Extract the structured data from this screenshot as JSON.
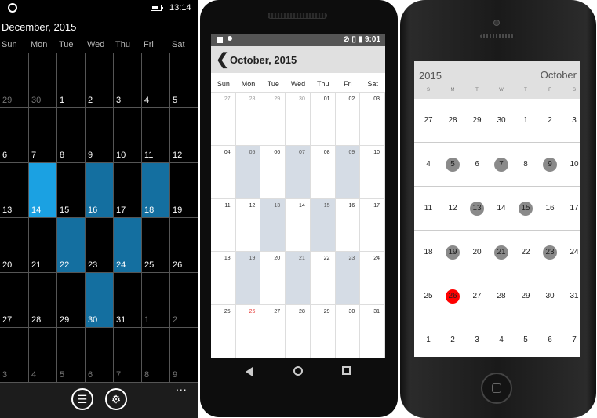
{
  "windows_phone": {
    "status": {
      "time": "13:14"
    },
    "month_title": "December, 2015",
    "weekdays": [
      "Sun",
      "Mon",
      "Tue",
      "Wed",
      "Thu",
      "Fri",
      "Sat"
    ],
    "weeks": [
      [
        {
          "d": "29",
          "o": true
        },
        {
          "d": "30",
          "o": true
        },
        {
          "d": "1"
        },
        {
          "d": "2"
        },
        {
          "d": "3"
        },
        {
          "d": "4"
        },
        {
          "d": "5"
        }
      ],
      [
        {
          "d": "6"
        },
        {
          "d": "7"
        },
        {
          "d": "8"
        },
        {
          "d": "9"
        },
        {
          "d": "10"
        },
        {
          "d": "11"
        },
        {
          "d": "12"
        }
      ],
      [
        {
          "d": "13"
        },
        {
          "d": "14",
          "s": "a"
        },
        {
          "d": "15"
        },
        {
          "d": "16",
          "s": "b"
        },
        {
          "d": "17"
        },
        {
          "d": "18",
          "s": "b"
        },
        {
          "d": "19"
        }
      ],
      [
        {
          "d": "20"
        },
        {
          "d": "21"
        },
        {
          "d": "22",
          "s": "b"
        },
        {
          "d": "23"
        },
        {
          "d": "24",
          "s": "b"
        },
        {
          "d": "25"
        },
        {
          "d": "26"
        }
      ],
      [
        {
          "d": "27"
        },
        {
          "d": "28"
        },
        {
          "d": "29"
        },
        {
          "d": "30",
          "s": "b"
        },
        {
          "d": "31"
        },
        {
          "d": "1",
          "o": true
        },
        {
          "d": "2",
          "o": true
        }
      ],
      [
        {
          "d": "3",
          "o": true
        },
        {
          "d": "4",
          "o": true
        },
        {
          "d": "5",
          "o": true
        },
        {
          "d": "6",
          "o": true
        },
        {
          "d": "7",
          "o": true
        },
        {
          "d": "8",
          "o": true
        },
        {
          "d": "9",
          "o": true
        }
      ]
    ],
    "appbar": {
      "list_icon": "list-icon",
      "settings_icon": "gear-icon",
      "more": "..."
    }
  },
  "android": {
    "status": {
      "time": "9:01"
    },
    "month_title": "October, 2015",
    "back_glyph": "❮",
    "weekdays": [
      "Sun",
      "Mon",
      "Tue",
      "Wed",
      "Thu",
      "Fri",
      "Sat"
    ],
    "weeks": [
      [
        {
          "d": "27",
          "o": true
        },
        {
          "d": "28",
          "o": true
        },
        {
          "d": "29",
          "o": true
        },
        {
          "d": "30",
          "o": true
        },
        {
          "d": "01"
        },
        {
          "d": "02"
        },
        {
          "d": "03"
        }
      ],
      [
        {
          "d": "04"
        },
        {
          "d": "05",
          "sh": true
        },
        {
          "d": "06"
        },
        {
          "d": "07",
          "sh": true
        },
        {
          "d": "08"
        },
        {
          "d": "09",
          "sh": true
        },
        {
          "d": "10"
        }
      ],
      [
        {
          "d": "11"
        },
        {
          "d": "12"
        },
        {
          "d": "13",
          "sh": true
        },
        {
          "d": "14"
        },
        {
          "d": "15",
          "sh": true
        },
        {
          "d": "16"
        },
        {
          "d": "17"
        }
      ],
      [
        {
          "d": "18"
        },
        {
          "d": "19",
          "sh": true
        },
        {
          "d": "20"
        },
        {
          "d": "21",
          "sh": true
        },
        {
          "d": "22"
        },
        {
          "d": "23",
          "sh": true
        },
        {
          "d": "24"
        }
      ],
      [
        {
          "d": "25"
        },
        {
          "d": "26",
          "red": true
        },
        {
          "d": "27"
        },
        {
          "d": "28"
        },
        {
          "d": "29"
        },
        {
          "d": "30"
        },
        {
          "d": "31"
        }
      ]
    ]
  },
  "iphone": {
    "year": "2015",
    "month": "October",
    "weekdays": [
      "S",
      "M",
      "T",
      "W",
      "T",
      "F",
      "S"
    ],
    "weeks": [
      [
        {
          "d": "27"
        },
        {
          "d": "28"
        },
        {
          "d": "29"
        },
        {
          "d": "30"
        },
        {
          "d": "1"
        },
        {
          "d": "2"
        },
        {
          "d": "3"
        }
      ],
      [
        {
          "d": "4"
        },
        {
          "d": "5",
          "m": true
        },
        {
          "d": "6"
        },
        {
          "d": "7",
          "m": true
        },
        {
          "d": "8"
        },
        {
          "d": "9",
          "m": true
        },
        {
          "d": "10"
        }
      ],
      [
        {
          "d": "11"
        },
        {
          "d": "12"
        },
        {
          "d": "13",
          "m": true
        },
        {
          "d": "14"
        },
        {
          "d": "15",
          "m": true
        },
        {
          "d": "16"
        },
        {
          "d": "17"
        }
      ],
      [
        {
          "d": "18"
        },
        {
          "d": "19",
          "m": true
        },
        {
          "d": "20"
        },
        {
          "d": "21",
          "m": true
        },
        {
          "d": "22"
        },
        {
          "d": "23",
          "m": true
        },
        {
          "d": "24"
        }
      ],
      [
        {
          "d": "25"
        },
        {
          "d": "26",
          "t": true
        },
        {
          "d": "27"
        },
        {
          "d": "28"
        },
        {
          "d": "29"
        },
        {
          "d": "30"
        },
        {
          "d": "31"
        }
      ],
      [
        {
          "d": "1"
        },
        {
          "d": "2"
        },
        {
          "d": "3"
        },
        {
          "d": "4"
        },
        {
          "d": "5"
        },
        {
          "d": "6"
        },
        {
          "d": "7"
        }
      ]
    ]
  },
  "colors": {
    "wp_selected_bright": "#1ba1e2",
    "wp_selected_dark": "#146fa0",
    "android_shaded": "#d5dce5",
    "android_today": "#e53935",
    "ios_marked": "#8a8a8a",
    "ios_today": "#ff0000"
  }
}
